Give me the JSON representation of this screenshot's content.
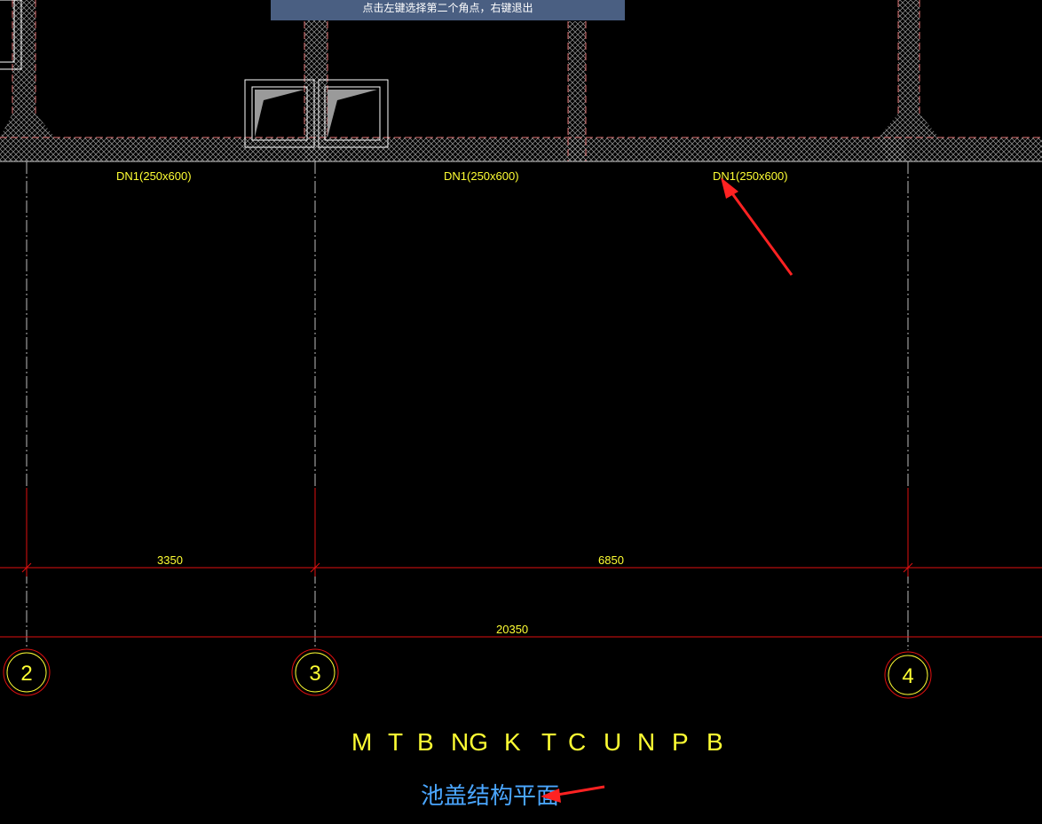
{
  "prompt": {
    "text": "点击左键选择第二个角点，右键退出"
  },
  "beams": {
    "labels": [
      "DN1(250x600)",
      "DN1(250x600)",
      "DN1(250x600)"
    ]
  },
  "dimensions": {
    "span_2_3": "3350",
    "span_3_4": "6850",
    "total": "20350"
  },
  "axes": {
    "labels": [
      "2",
      "3",
      "4"
    ]
  },
  "garbled_text": {
    "letters": [
      "M",
      "T",
      "B",
      "NG",
      "K",
      "T",
      "C",
      "U",
      "N",
      "P",
      "B"
    ]
  },
  "drawing_title": "池盖结构平面",
  "colors": {
    "background": "#000000",
    "text_yellow": "#ffff33",
    "dim_red": "#e01010",
    "title_blue": "#4aa6ff",
    "prompt_bg": "#4a5f82",
    "hatch": "#bbbbbb",
    "annotation_arrow": "#ff2222"
  }
}
